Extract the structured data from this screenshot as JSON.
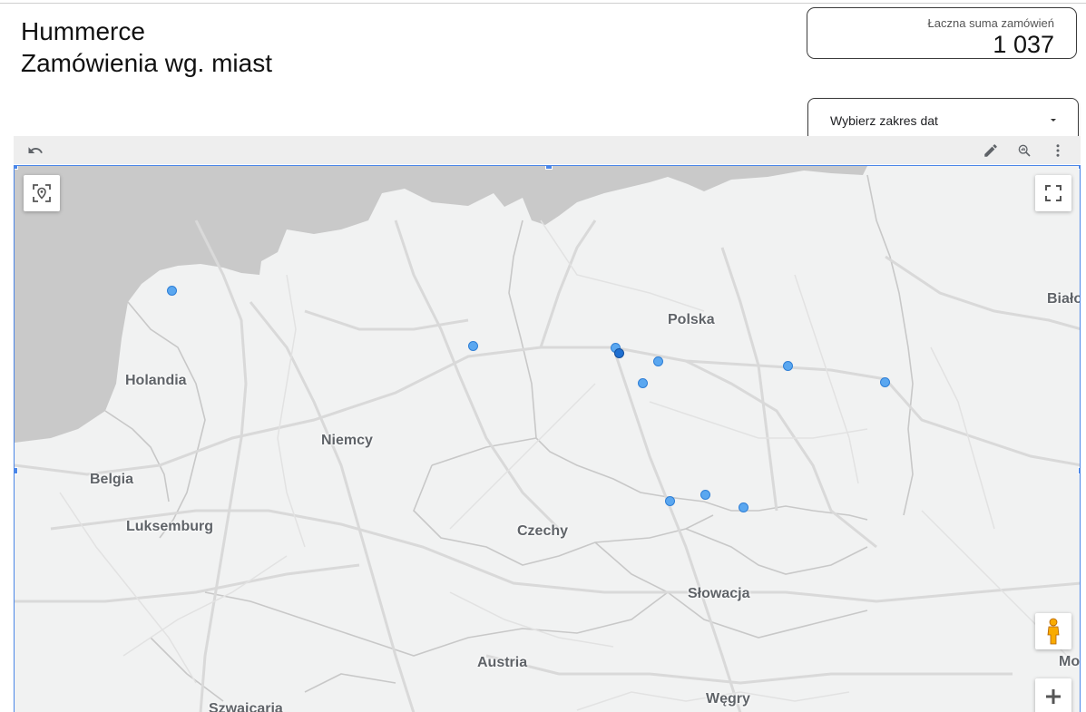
{
  "header": {
    "title_line1": "Hummerce",
    "title_line2": "Zamówienia wg. miast"
  },
  "scorecard": {
    "label": "Łaczna suma zamówień",
    "value": "1 037"
  },
  "date_range": {
    "label": "Wybierz zakres dat"
  },
  "toolbar": {
    "icons": [
      "undo-icon",
      "pencil-icon",
      "zoom-data-icon",
      "more-vert-icon"
    ]
  },
  "map": {
    "labels": {
      "polska": "Polska",
      "holandia": "Holandia",
      "niemcy": "Niemcy",
      "belgia": "Belgia",
      "luksemburg": "Luksemburg",
      "czechy": "Czechy",
      "slowacja": "Słowacja",
      "austria": "Austria",
      "wegry": "Węgry",
      "szwajcaria": "Szwajcaria",
      "bialorus": "Biało",
      "mo": "Mo"
    },
    "controls": [
      "locate-icon",
      "fullscreen-icon",
      "pegman-icon",
      "zoom-in-icon"
    ],
    "colors": {
      "marker": "#5aa7f0",
      "marker_dark": "#1f6fd1",
      "water": "#c9c9c9",
      "land": "#f1f2f2",
      "selection": "#4a86e8"
    }
  }
}
